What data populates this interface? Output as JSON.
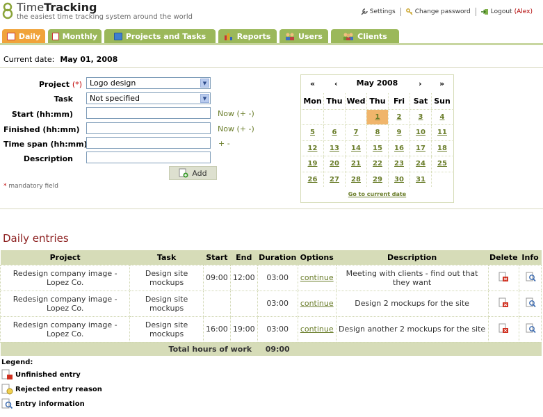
{
  "header": {
    "title_time": "Time",
    "title_tracking": "Tracking",
    "tagline": "the easiest time tracking system around the world",
    "links": {
      "settings": "Settings",
      "change_password": "Change password",
      "logout": "Logout",
      "user": "Alex"
    }
  },
  "tabs": [
    {
      "label": "Daily",
      "active": true
    },
    {
      "label": "Monthly",
      "active": false
    },
    {
      "label": "Projects and Tasks",
      "active": false
    },
    {
      "label": "Reports",
      "active": false
    },
    {
      "label": "Users",
      "active": false
    },
    {
      "label": "Clients",
      "active": false
    }
  ],
  "current_date": {
    "label": "Current date:",
    "value": "May 01, 2008"
  },
  "form": {
    "project_label": "Project",
    "required_mark": "(*)",
    "project_value": "Logo design",
    "task_label": "Task",
    "task_value": "Not specified",
    "start_label": "Start (hh:mm)",
    "finished_label": "Finished (hh:mm)",
    "timespan_label": "Time span (hh:mm)",
    "description_label": "Description",
    "now_label": "Now",
    "plus_minus": "(+ -)",
    "timespan_pm": "+ -",
    "add_label": "Add",
    "mandatory_star": "*",
    "mandatory_text": "mandatory field"
  },
  "calendar": {
    "month": "May 2008",
    "nav": {
      "prev_year": "«",
      "prev_month": "‹",
      "next_month": "›",
      "next_year": "»"
    },
    "weekdays": [
      "Mon",
      "Thu",
      "Wed",
      "Thu",
      "Fri",
      "Sat",
      "Sun"
    ],
    "weeks": [
      [
        "",
        "",
        "",
        "1",
        "2",
        "3",
        "4"
      ],
      [
        "5",
        "6",
        "7",
        "8",
        "9",
        "10",
        "11"
      ],
      [
        "12",
        "13",
        "14",
        "15",
        "16",
        "17",
        "18"
      ],
      [
        "19",
        "20",
        "21",
        "22",
        "23",
        "24",
        "25"
      ],
      [
        "26",
        "27",
        "28",
        "29",
        "30",
        "31",
        ""
      ]
    ],
    "today": "1",
    "go_current": "Go to current date"
  },
  "daily": {
    "title": "Daily entries",
    "columns": [
      "Project",
      "Task",
      "Start",
      "End",
      "Duration",
      "Options",
      "Description",
      "Delete",
      "Info"
    ],
    "rows": [
      {
        "project": "Redesign company image - Lopez Co.",
        "task": "Design site mockups",
        "start": "09:00",
        "end": "12:00",
        "duration": "03:00",
        "option": "continue",
        "description": "Meeting with clients - find out that they want"
      },
      {
        "project": "Redesign company image - Lopez Co.",
        "task": "Design site mockups",
        "start": "",
        "end": "",
        "duration": "03:00",
        "option": "continue",
        "description": "Design 2 mockups for the site"
      },
      {
        "project": "Redesign company image - Lopez Co.",
        "task": "Design site mockups",
        "start": "16:00",
        "end": "19:00",
        "duration": "03:00",
        "option": "continue",
        "description": "Design another 2 mockups for the site"
      }
    ],
    "total_label": "Total hours of work",
    "total_value": "09:00"
  },
  "legend": {
    "title": "Legend:",
    "items": [
      "Unfinished entry",
      "Rejected entry reason",
      "Entry information"
    ]
  },
  "colors": {
    "tab_green": "#9bb85a",
    "tab_active": "#f0a33a",
    "header_row": "#d6dcb8",
    "title_red": "#8b1d1d",
    "link_green": "#6a7d2a"
  }
}
